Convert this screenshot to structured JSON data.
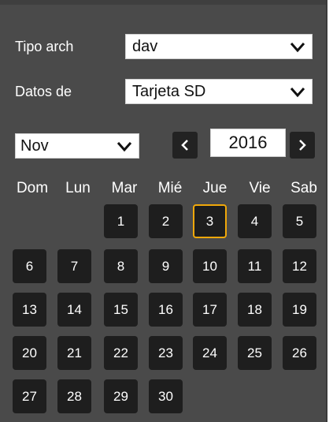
{
  "filters": {
    "file_type": {
      "label": "Tipo arch",
      "value": "dav"
    },
    "data_source": {
      "label": "Datos de",
      "value": "Tarjeta SD"
    }
  },
  "calendar": {
    "month": "Nov",
    "year": "2016",
    "prev_icon": "chevron-left-icon",
    "next_icon": "chevron-right-icon",
    "weekdays": [
      "Dom",
      "Lun",
      "Mar",
      "Mié",
      "Jue",
      "Vie",
      "Sab"
    ],
    "first_weekday_index": 2,
    "days_in_month": 30,
    "selected_day": 3,
    "days": [
      "1",
      "2",
      "3",
      "4",
      "5",
      "6",
      "7",
      "8",
      "9",
      "10",
      "11",
      "12",
      "13",
      "14",
      "15",
      "16",
      "17",
      "18",
      "19",
      "20",
      "21",
      "22",
      "23",
      "24",
      "25",
      "26",
      "27",
      "28",
      "29",
      "30"
    ]
  },
  "colors": {
    "panel": "#4a4a4a",
    "day_cell": "#1e1e1e",
    "selected_border": "#f0a80a"
  }
}
